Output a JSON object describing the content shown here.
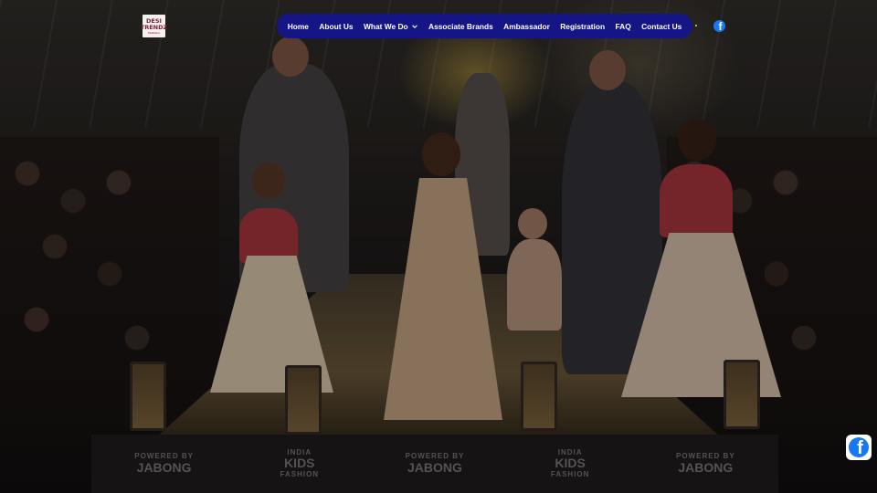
{
  "logo": {
    "line1": "DESI",
    "line2": "TRENDZ",
    "tagline": "fashion"
  },
  "nav": {
    "items": [
      {
        "label": "Home"
      },
      {
        "label": "About Us"
      },
      {
        "label": "What We Do"
      },
      {
        "label": "Associate Brands"
      },
      {
        "label": "Ambassador"
      },
      {
        "label": "Registration"
      },
      {
        "label": "FAQ"
      },
      {
        "label": "Contact Us"
      }
    ],
    "dropdown_icon": "chevron-down-icon"
  },
  "social": {
    "facebook_icon": "facebook-icon",
    "facebook_glyph": "f"
  },
  "hero": {
    "banner": [
      {
        "top": "POWERED BY",
        "main": "JABONG"
      },
      {
        "top": "INDIA",
        "main": "KIDS",
        "bottom": "FASHION"
      },
      {
        "top": "POWERED BY",
        "main": "JABONG"
      },
      {
        "top": "INDIA",
        "main": "KIDS",
        "bottom": "FASHION"
      },
      {
        "top": "POWERED BY",
        "main": "JABONG"
      }
    ]
  },
  "colors": {
    "nav_bg": "#151585",
    "facebook": "#1877f2"
  }
}
